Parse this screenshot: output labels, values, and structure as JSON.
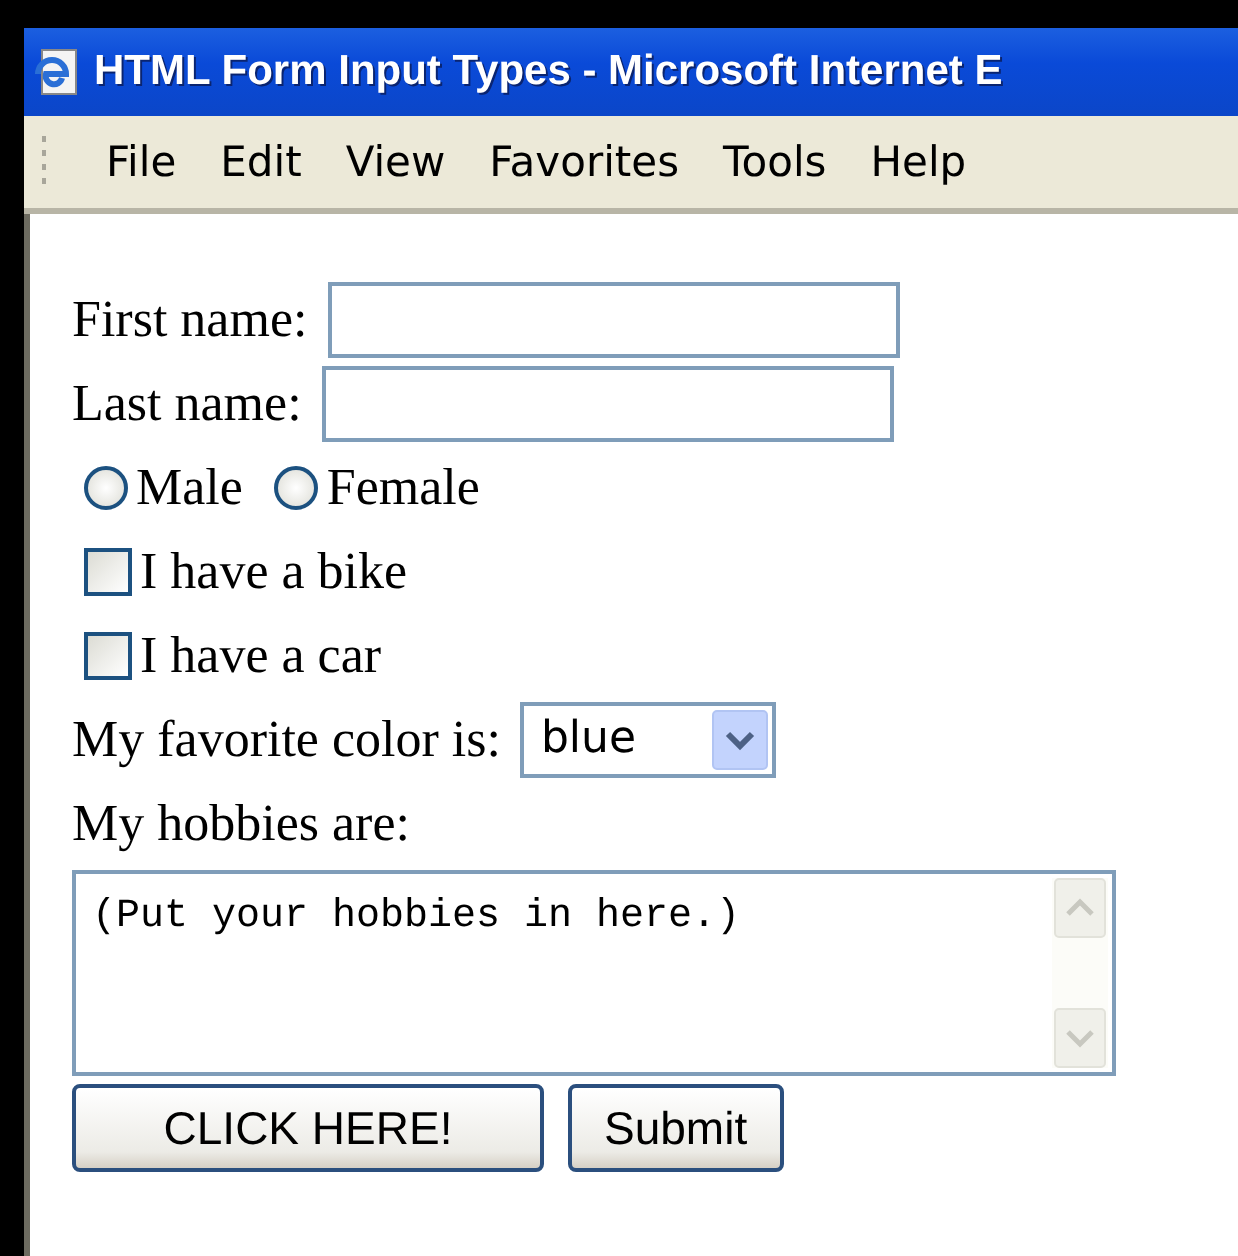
{
  "window": {
    "title": "HTML Form Input Types - Microsoft Internet E"
  },
  "menu": [
    "File",
    "Edit",
    "View",
    "Favorites",
    "Tools",
    "Help"
  ],
  "form": {
    "text_fields": [
      {
        "label": "First name:"
      },
      {
        "label": "Last name:"
      }
    ],
    "radios": [
      {
        "label": "Male",
        "selected": false
      },
      {
        "label": "Female",
        "selected": false
      }
    ],
    "checkboxes": [
      {
        "label": "I have a bike",
        "checked": false
      },
      {
        "label": "I have a car",
        "checked": false
      }
    ],
    "select": {
      "label": "My favorite color is:",
      "value": "blue"
    },
    "textarea": {
      "label": "My hobbies are:",
      "value": "(Put your hobbies in here.)"
    },
    "buttons": [
      "CLICK HERE!",
      "Submit"
    ]
  }
}
